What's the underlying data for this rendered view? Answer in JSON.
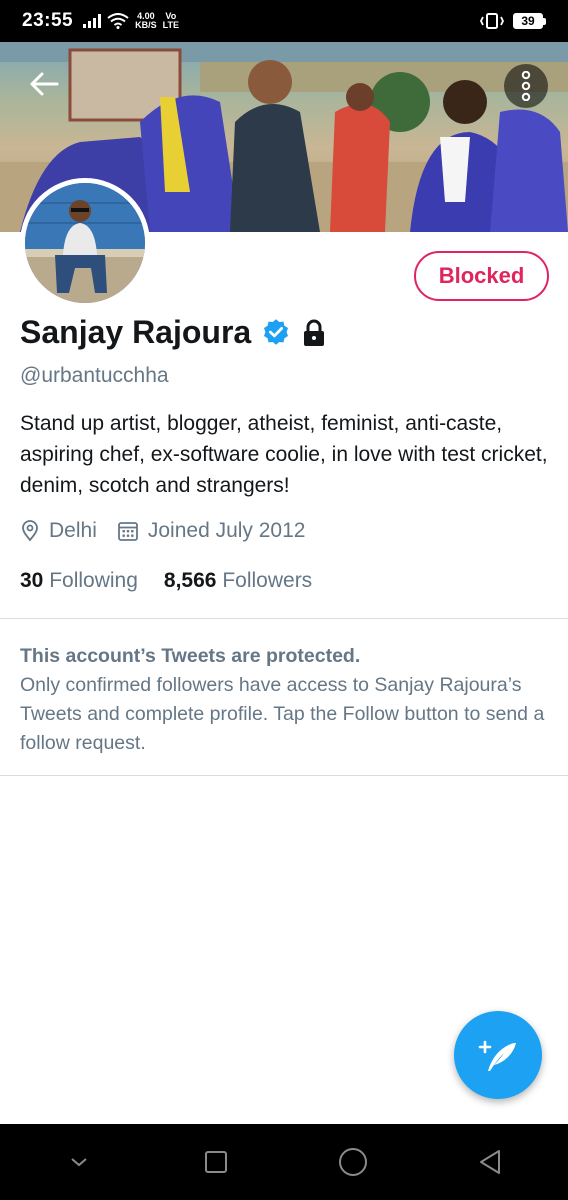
{
  "status_bar": {
    "time": "23:55",
    "speed_value": "4.00",
    "speed_unit": "KB/S",
    "net_top": "Vo",
    "net_bottom": "LTE",
    "battery": "39"
  },
  "profile": {
    "name": "Sanjay Rajoura",
    "handle": "@urbantucchha",
    "bio": "Stand up artist, blogger, atheist, feminist, anti-caste, aspiring chef, ex-software coolie, in love with test cricket, denim, scotch and strangers!",
    "location": "Delhi",
    "joined": "Joined July 2012",
    "following_count": "30",
    "following_label": "Following",
    "followers_count": "8,566",
    "followers_label": "Followers",
    "blocked_label": "Blocked"
  },
  "protected": {
    "title": "This account’s Tweets are protected.",
    "body": "Only confirmed followers have access to Sanjay Rajoura’s Tweets and complete profile. Tap the Follow button to send a follow request."
  },
  "icons": {
    "back": "back-arrow-icon",
    "more": "more-vertical-icon",
    "verified": "verified-badge-icon",
    "lock": "lock-icon",
    "location": "location-pin-icon",
    "calendar": "calendar-icon",
    "compose": "compose-tweet-icon"
  },
  "colors": {
    "accent": "#1da1f2",
    "blocked": "#e0245e",
    "secondary_text": "#657786"
  }
}
